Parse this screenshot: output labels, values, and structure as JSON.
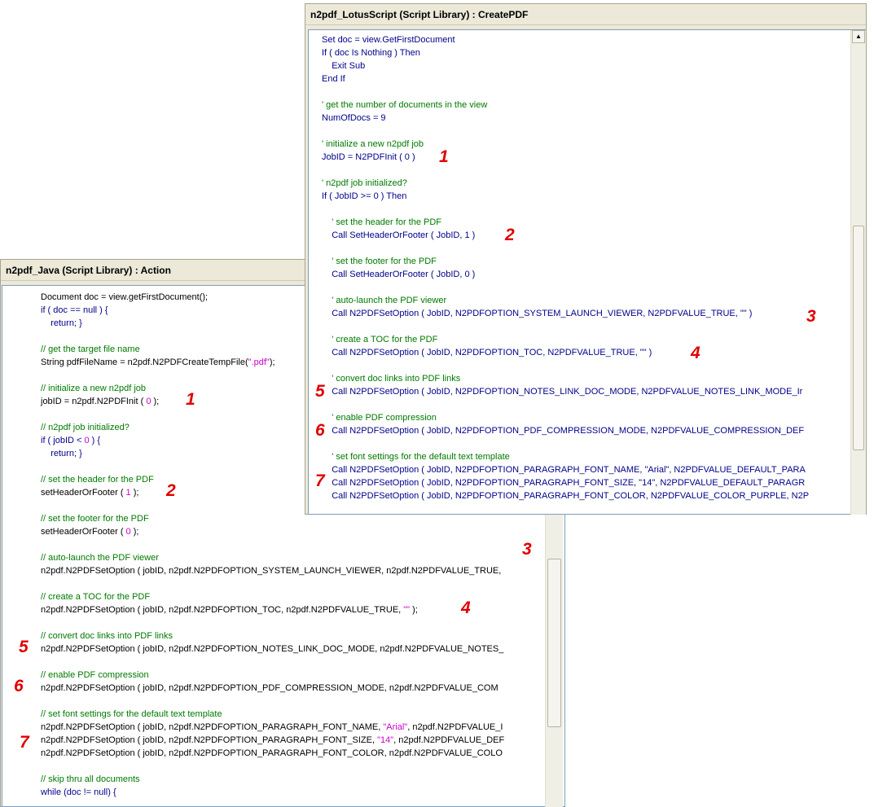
{
  "java": {
    "title": "n2pdf_Java (Script Library) : Action",
    "lines": [
      [
        {
          "t": "Document doc = view.getFirstDocument();",
          "c": "c-jc"
        }
      ],
      [
        {
          "t": "if ( doc == null ) {",
          "c": "c-kw"
        }
      ],
      [
        {
          "t": "    return; }",
          "c": "c-kw"
        }
      ],
      [],
      [
        {
          "t": "// get the target file name",
          "c": "c-cm"
        }
      ],
      [
        {
          "t": "String pdfFileName = n2pdf.N2PDFCreateTempFile(",
          "c": "c-jc"
        },
        {
          "t": "\".pdf\"",
          "c": "c-str"
        },
        {
          "t": ");",
          "c": "c-jc"
        }
      ],
      [],
      [
        {
          "t": "// initialize a new n2pdf job",
          "c": "c-cm"
        }
      ],
      [
        {
          "t": "jobID = n2pdf.N2PDFInit ( ",
          "c": "c-jc"
        },
        {
          "t": "0",
          "c": "c-str"
        },
        {
          "t": " );",
          "c": "c-jc"
        }
      ],
      [],
      [
        {
          "t": "// n2pdf job initialized?",
          "c": "c-cm"
        }
      ],
      [
        {
          "t": "if ( jobID < ",
          "c": "c-kw"
        },
        {
          "t": "0",
          "c": "c-str"
        },
        {
          "t": " ) {",
          "c": "c-kw"
        }
      ],
      [
        {
          "t": "    return; }",
          "c": "c-kw"
        }
      ],
      [],
      [
        {
          "t": "// set the header for the PDF",
          "c": "c-cm"
        }
      ],
      [
        {
          "t": "setHeaderOrFooter ( ",
          "c": "c-jc"
        },
        {
          "t": "1",
          "c": "c-str"
        },
        {
          "t": " );",
          "c": "c-jc"
        }
      ],
      [],
      [
        {
          "t": "// set the footer for the PDF",
          "c": "c-cm"
        }
      ],
      [
        {
          "t": "setHeaderOrFooter ( ",
          "c": "c-jc"
        },
        {
          "t": "0",
          "c": "c-str"
        },
        {
          "t": " );",
          "c": "c-jc"
        }
      ],
      [],
      [
        {
          "t": "// auto-launch the PDF viewer",
          "c": "c-cm"
        }
      ],
      [
        {
          "t": "n2pdf.N2PDFSetOption ( jobID, n2pdf.N2PDFOPTION_SYSTEM_LAUNCH_VIEWER, n2pdf.N2PDFVALUE_TRUE, ",
          "c": "c-jc"
        }
      ],
      [],
      [
        {
          "t": "// create a TOC for the PDF",
          "c": "c-cm"
        }
      ],
      [
        {
          "t": "n2pdf.N2PDFSetOption ( jobID, n2pdf.N2PDFOPTION_TOC, n2pdf.N2PDFVALUE_TRUE, ",
          "c": "c-jc"
        },
        {
          "t": "\"\"",
          "c": "c-str"
        },
        {
          "t": " );",
          "c": "c-jc"
        }
      ],
      [],
      [
        {
          "t": "// convert doc links into PDF links",
          "c": "c-cm"
        }
      ],
      [
        {
          "t": "n2pdf.N2PDFSetOption ( jobID, n2pdf.N2PDFOPTION_NOTES_LINK_DOC_MODE, n2pdf.N2PDFVALUE_NOTES_",
          "c": "c-jc"
        }
      ],
      [],
      [
        {
          "t": "// enable PDF compression",
          "c": "c-cm"
        }
      ],
      [
        {
          "t": "n2pdf.N2PDFSetOption ( jobID, n2pdf.N2PDFOPTION_PDF_COMPRESSION_MODE, n2pdf.N2PDFVALUE_COM",
          "c": "c-jc"
        }
      ],
      [],
      [
        {
          "t": "// set font settings for the default text template",
          "c": "c-cm"
        }
      ],
      [
        {
          "t": "n2pdf.N2PDFSetOption ( jobID, n2pdf.N2PDFOPTION_PARAGRAPH_FONT_NAME, ",
          "c": "c-jc"
        },
        {
          "t": "\"Arial\"",
          "c": "c-str"
        },
        {
          "t": ", n2pdf.N2PDFVALUE_I",
          "c": "c-jc"
        }
      ],
      [
        {
          "t": "n2pdf.N2PDFSetOption ( jobID, n2pdf.N2PDFOPTION_PARAGRAPH_FONT_SIZE, ",
          "c": "c-jc"
        },
        {
          "t": "\"14\"",
          "c": "c-str"
        },
        {
          "t": ", n2pdf.N2PDFVALUE_DEF",
          "c": "c-jc"
        }
      ],
      [
        {
          "t": "n2pdf.N2PDFSetOption ( jobID, n2pdf.N2PDFOPTION_PARAGRAPH_FONT_COLOR, n2pdf.N2PDFVALUE_COLO",
          "c": "c-jc"
        }
      ],
      [],
      [
        {
          "t": "// skip thru all documents",
          "c": "c-cm"
        }
      ],
      [
        {
          "t": "while (doc != null) {",
          "c": "c-kw"
        }
      ]
    ],
    "markers": [
      "1",
      "2",
      "3",
      "4",
      "5",
      "6",
      "7"
    ]
  },
  "lotus": {
    "title": "n2pdf_LotusScript (Script Library) : CreatePDF",
    "lines": [
      [
        {
          "t": "Set doc = view.GetFirstDocument",
          "c": "c-kw"
        }
      ],
      [
        {
          "t": "If ( doc Is Nothing ) Then",
          "c": "c-kw"
        }
      ],
      [
        {
          "t": "    Exit Sub",
          "c": "c-kw"
        }
      ],
      [
        {
          "t": "End If",
          "c": "c-kw"
        }
      ],
      [],
      [
        {
          "t": "' get the number of documents in the view",
          "c": "c-cm"
        }
      ],
      [
        {
          "t": "NumOfDocs = 9",
          "c": "c-kw"
        }
      ],
      [],
      [
        {
          "t": "' initialize a new n2pdf job",
          "c": "c-cm"
        }
      ],
      [
        {
          "t": "JobID = N2PDFInit ( 0 )",
          "c": "c-kw"
        }
      ],
      [],
      [
        {
          "t": "' n2pdf job initialized?",
          "c": "c-cm"
        }
      ],
      [
        {
          "t": "If ( JobID >= 0 ) Then",
          "c": "c-kw"
        }
      ],
      [],
      [
        {
          "t": "    ' set the header for the PDF",
          "c": "c-cm"
        }
      ],
      [
        {
          "t": "    Call SetHeaderOrFooter ( JobID, 1 )",
          "c": "c-kw"
        }
      ],
      [],
      [
        {
          "t": "    ' set the footer for the PDF",
          "c": "c-cm"
        }
      ],
      [
        {
          "t": "    Call SetHeaderOrFooter ( JobID, 0 )",
          "c": "c-kw"
        }
      ],
      [],
      [
        {
          "t": "    ' auto-launch the PDF viewer",
          "c": "c-cm"
        }
      ],
      [
        {
          "t": "    Call N2PDFSetOption ( JobID, N2PDFOPTION_SYSTEM_LAUNCH_VIEWER, N2PDFVALUE_TRUE, \"\" )",
          "c": "c-kw"
        }
      ],
      [],
      [
        {
          "t": "    ' create a TOC for the PDF",
          "c": "c-cm"
        }
      ],
      [
        {
          "t": "    Call N2PDFSetOption ( JobID, N2PDFOPTION_TOC, N2PDFVALUE_TRUE, \"\" )",
          "c": "c-kw"
        }
      ],
      [],
      [
        {
          "t": "    ' convert doc links into PDF links",
          "c": "c-cm"
        }
      ],
      [
        {
          "t": "    Call N2PDFSetOption ( JobID, N2PDFOPTION_NOTES_LINK_DOC_MODE, N2PDFVALUE_NOTES_LINK_MODE_Ir",
          "c": "c-kw"
        }
      ],
      [],
      [
        {
          "t": "    ' enable PDF compression",
          "c": "c-cm"
        }
      ],
      [
        {
          "t": "    Call N2PDFSetOption ( JobID, N2PDFOPTION_PDF_COMPRESSION_MODE, N2PDFVALUE_COMPRESSION_DEF",
          "c": "c-kw"
        }
      ],
      [],
      [
        {
          "t": "    ' set font settings for the default text template",
          "c": "c-cm"
        }
      ],
      [
        {
          "t": "    Call N2PDFSetOption ( JobID, N2PDFOPTION_PARAGRAPH_FONT_NAME, \"Arial\", N2PDFVALUE_DEFAULT_PARA",
          "c": "c-kw"
        }
      ],
      [
        {
          "t": "    Call N2PDFSetOption ( JobID, N2PDFOPTION_PARAGRAPH_FONT_SIZE, \"14\", N2PDFVALUE_DEFAULT_PARAGR",
          "c": "c-kw"
        }
      ],
      [
        {
          "t": "    Call N2PDFSetOption ( JobID, N2PDFOPTION_PARAGRAPH_FONT_COLOR, N2PDFVALUE_COLOR_PURPLE, N2P",
          "c": "c-kw"
        }
      ]
    ],
    "markers": [
      "1",
      "2",
      "3",
      "4",
      "5",
      "6",
      "7"
    ]
  },
  "icons": {
    "scroll_up": "up-arrow-icon"
  }
}
